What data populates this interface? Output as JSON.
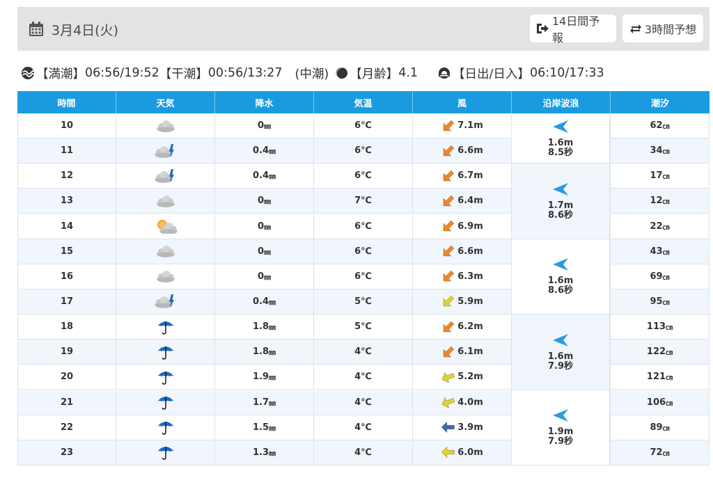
{
  "header": {
    "date": "3月4日(火)",
    "btn_14": "14日間予報",
    "btn_3h": "3時間予想"
  },
  "tide": {
    "high_label": "【満潮】",
    "high": "06:56/19:52",
    "low_label": "【干潮】",
    "low": "00:56/13:27",
    "type": "(中潮)",
    "moon_label": "【月齢】",
    "moon": "4.1",
    "sun_label": "【日出/日入】",
    "sun": "06:10/17:33"
  },
  "columns": [
    "時間",
    "天気",
    "降水",
    "気温",
    "風",
    "沿岸波浪",
    "潮汐"
  ],
  "rows": [
    {
      "hour": "10",
      "weather": "cloudy-icon",
      "precip": "0",
      "precip_unit": "㎜",
      "temp": "6℃",
      "wind_icon": "wind-arrow-southwest-icon",
      "wind_color": "#e8892b",
      "wind": "7.1m",
      "tide": "62",
      "tide_unit": "㎝"
    },
    {
      "hour": "11",
      "weather": "cloud-rain-icon",
      "precip": "0.4",
      "precip_unit": "㎜",
      "temp": "6℃",
      "wind_icon": "wind-arrow-southwest-icon",
      "wind_color": "#e8892b",
      "wind": "6.6m",
      "tide": "34",
      "tide_unit": "㎝"
    },
    {
      "hour": "12",
      "weather": "cloud-rain-icon",
      "precip": "0.4",
      "precip_unit": "㎜",
      "temp": "6℃",
      "wind_icon": "wind-arrow-southwest-icon",
      "wind_color": "#e8892b",
      "wind": "6.7m",
      "tide": "17",
      "tide_unit": "㎝"
    },
    {
      "hour": "13",
      "weather": "cloudy-icon",
      "precip": "0",
      "precip_unit": "㎜",
      "temp": "7℃",
      "wind_icon": "wind-arrow-southwest-icon",
      "wind_color": "#e8892b",
      "wind": "6.4m",
      "tide": "12",
      "tide_unit": "㎝"
    },
    {
      "hour": "14",
      "weather": "sun-cloud-icon",
      "precip": "0",
      "precip_unit": "㎜",
      "temp": "6℃",
      "wind_icon": "wind-arrow-southwest-icon",
      "wind_color": "#e8892b",
      "wind": "6.9m",
      "tide": "22",
      "tide_unit": "㎝"
    },
    {
      "hour": "15",
      "weather": "cloudy-icon",
      "precip": "0",
      "precip_unit": "㎜",
      "temp": "6℃",
      "wind_icon": "wind-arrow-southwest-icon",
      "wind_color": "#e8892b",
      "wind": "6.6m",
      "tide": "43",
      "tide_unit": "㎝"
    },
    {
      "hour": "16",
      "weather": "cloudy-icon",
      "precip": "0",
      "precip_unit": "㎜",
      "temp": "6℃",
      "wind_icon": "wind-arrow-southwest-icon",
      "wind_color": "#e8892b",
      "wind": "6.3m",
      "tide": "69",
      "tide_unit": "㎝"
    },
    {
      "hour": "17",
      "weather": "cloud-rain-icon",
      "precip": "0.4",
      "precip_unit": "㎜",
      "temp": "5℃",
      "wind_icon": "wind-arrow-southwest-icon",
      "wind_color": "#d9d430",
      "wind": "5.9m",
      "tide": "95",
      "tide_unit": "㎝"
    },
    {
      "hour": "18",
      "weather": "umbrella-icon",
      "precip": "1.8",
      "precip_unit": "㎜",
      "temp": "5℃",
      "wind_icon": "wind-arrow-southwest-icon",
      "wind_color": "#e8892b",
      "wind": "6.2m",
      "tide": "113",
      "tide_unit": "㎝"
    },
    {
      "hour": "19",
      "weather": "umbrella-icon",
      "precip": "1.8",
      "precip_unit": "㎜",
      "temp": "4℃",
      "wind_icon": "wind-arrow-southwest-icon",
      "wind_color": "#e8892b",
      "wind": "6.1m",
      "tide": "122",
      "tide_unit": "㎝"
    },
    {
      "hour": "20",
      "weather": "umbrella-icon",
      "precip": "1.9",
      "precip_unit": "㎜",
      "temp": "4℃",
      "wind_icon": "wind-arrow-west-southwest-icon",
      "wind_color": "#d9d430",
      "wind": "5.2m",
      "tide": "121",
      "tide_unit": "㎝"
    },
    {
      "hour": "21",
      "weather": "umbrella-icon",
      "precip": "1.7",
      "precip_unit": "㎜",
      "temp": "4℃",
      "wind_icon": "wind-arrow-west-southwest-icon",
      "wind_color": "#d9d430",
      "wind": "4.0m",
      "tide": "106",
      "tide_unit": "㎝"
    },
    {
      "hour": "22",
      "weather": "umbrella-icon",
      "precip": "1.5",
      "precip_unit": "㎜",
      "temp": "4℃",
      "wind_icon": "wind-arrow-west-icon",
      "wind_color": "#2f6fb8",
      "wind": "3.9m",
      "tide": "89",
      "tide_unit": "㎝"
    },
    {
      "hour": "23",
      "weather": "umbrella-icon",
      "precip": "1.3",
      "precip_unit": "㎜",
      "temp": "4℃",
      "wind_icon": "wind-arrow-west-icon",
      "wind_color": "#d9d430",
      "wind": "6.0m",
      "tide": "72",
      "tide_unit": "㎝"
    }
  ],
  "waves": [
    {
      "height": "1.6m",
      "period": "8.5秒",
      "rows": 2
    },
    {
      "height": "1.7m",
      "period": "8.6秒",
      "rows": 3
    },
    {
      "height": "1.6m",
      "period": "8.6秒",
      "rows": 3
    },
    {
      "height": "1.6m",
      "period": "7.9秒",
      "rows": 3
    },
    {
      "height": "1.9m",
      "period": "7.9秒",
      "rows": 3
    }
  ],
  "colors": {
    "header_blue": "#1a9be0",
    "row_alt": "#f0f6fc",
    "wave_arrow": "#2a9be0",
    "umbrella": "#1f6ac1"
  }
}
